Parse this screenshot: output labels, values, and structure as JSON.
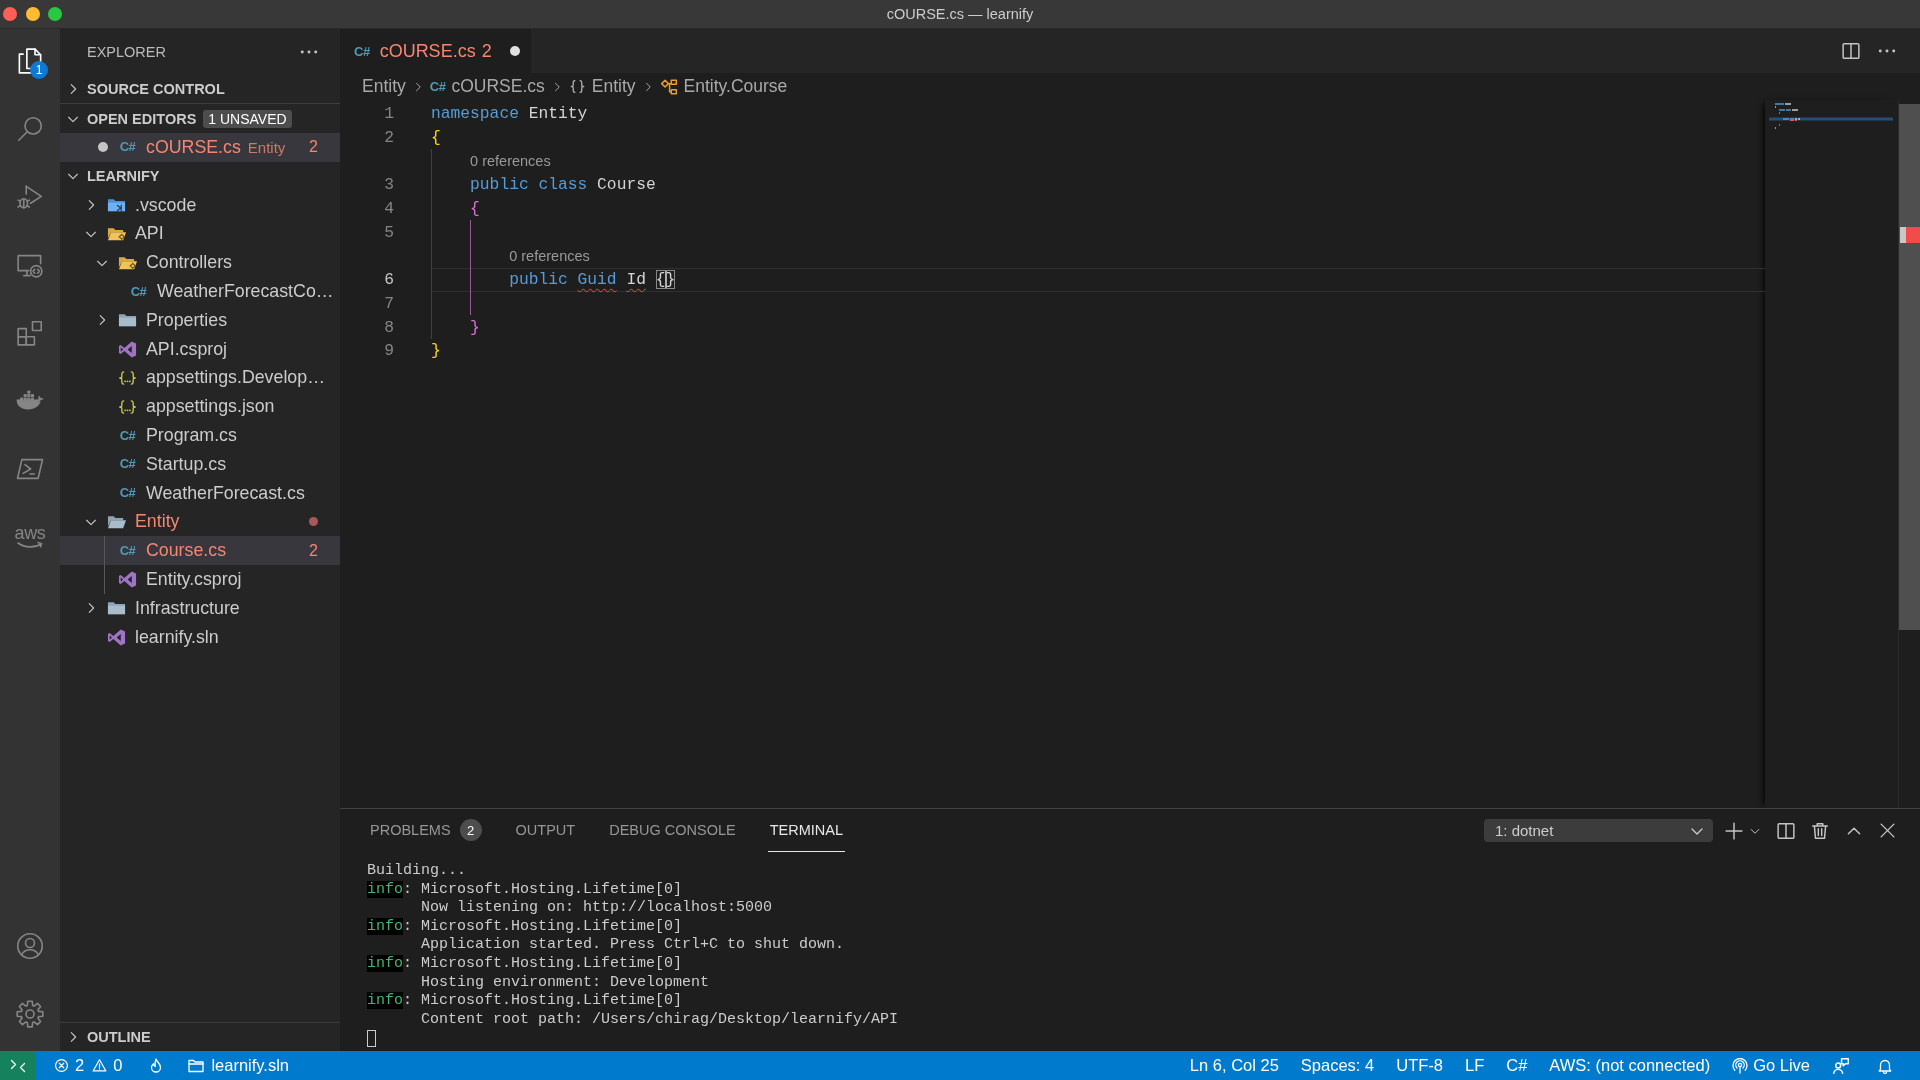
{
  "window": {
    "title": "cOURSE.cs — learnify"
  },
  "activity_bar": {
    "items": [
      {
        "kind": "explorer",
        "selected": true,
        "badge": "1"
      },
      {
        "kind": "search",
        "selected": false
      },
      {
        "kind": "debug",
        "selected": false
      },
      {
        "kind": "remote",
        "selected": false
      },
      {
        "kind": "extensions",
        "selected": false
      },
      {
        "kind": "docker",
        "selected": false
      },
      {
        "kind": "terminal",
        "selected": false
      },
      {
        "kind": "aws",
        "selected": false,
        "label": "aws"
      }
    ],
    "bottom_items": [
      {
        "kind": "account"
      },
      {
        "kind": "settings"
      }
    ]
  },
  "sidebar": {
    "title": "EXPLORER",
    "sections": [
      {
        "title": "SOURCE CONTROL",
        "expanded": false
      },
      {
        "title": "OPEN EDITORS",
        "expanded": true,
        "badge": "1 UNSAVED",
        "items": [
          {
            "kind": "csharp",
            "icon": "C#",
            "name": "cOURSE.cs",
            "description": "Entity",
            "problems": "2",
            "dirty": true,
            "error": true,
            "selected": true
          }
        ]
      },
      {
        "title": "LEARNIFY",
        "expanded": true,
        "tree": [
          {
            "kind": "vscodefolder",
            "name": ".vscode",
            "expanded": false,
            "selected": false,
            "error": false
          },
          {
            "kind": "gearfolder",
            "name": "API",
            "expanded": true,
            "selected": false,
            "error": false,
            "children": [
              {
                "kind": "gearfolder",
                "name": "Controllers",
                "expanded": true,
                "selected": false,
                "error": false,
                "children": [
                  {
                    "kind": "csharp",
                    "icon": "C#",
                    "name": "WeatherForecastCo…",
                    "selected": false,
                    "error": false
                  }
                ]
              },
              {
                "kind": "folder",
                "name": "Properties",
                "expanded": false,
                "selected": false,
                "error": false
              },
              {
                "kind": "msbuild",
                "name": "API.csproj",
                "selected": false,
                "error": false
              },
              {
                "kind": "json",
                "name": "appsettings.Develop…",
                "selected": false,
                "error": false
              },
              {
                "kind": "json",
                "name": "appsettings.json",
                "selected": false,
                "error": false
              },
              {
                "kind": "csharp",
                "icon": "C#",
                "name": "Program.cs",
                "selected": false,
                "error": false
              },
              {
                "kind": "csharp",
                "icon": "C#",
                "name": "Startup.cs",
                "selected": false,
                "error": false
              },
              {
                "kind": "csharp",
                "icon": "C#",
                "name": "WeatherForecast.cs",
                "selected": false,
                "error": false
              }
            ]
          },
          {
            "kind": "folder",
            "name": "Entity",
            "expanded": true,
            "selected": false,
            "error": true,
            "children": [
              {
                "kind": "csharp",
                "icon": "C#",
                "name": "Course.cs",
                "selected": true,
                "error": true,
                "problems": "2"
              },
              {
                "kind": "msbuild",
                "name": "Entity.csproj",
                "selected": false,
                "error": false
              }
            ]
          },
          {
            "kind": "folder",
            "name": "Infrastructure",
            "expanded": false,
            "selected": false,
            "error": false
          },
          {
            "kind": "msbuild",
            "name": "learnify.sln",
            "selected": false,
            "error": false
          }
        ]
      },
      {
        "title": "OUTLINE",
        "expanded": false
      }
    ]
  },
  "editor": {
    "tabs": [
      {
        "kind": "csharp",
        "icon": "C#",
        "name": "cOURSE.cs",
        "problems": "2",
        "dirty": true,
        "error": true,
        "selected": true
      }
    ],
    "breadcrumbs": [
      {
        "kind": "folder",
        "text": "Entity"
      },
      {
        "kind": "csharp",
        "icon": "C#",
        "text": "cOURSE.cs"
      },
      {
        "kind": "namespace",
        "text": "Entity"
      },
      {
        "kind": "class",
        "text": "Entity.Course"
      }
    ],
    "lines": [
      {
        "kind": "code",
        "number": "1",
        "active": false,
        "tokens": [
          {
            "kind": "keyword",
            "text": "namespace",
            "error": false,
            "cursor": false
          },
          {
            "kind": "plain",
            "text": "Entity",
            "error": false,
            "cursor": false
          }
        ]
      },
      {
        "kind": "code",
        "number": "2",
        "active": false,
        "tokens": [
          {
            "kind": "open",
            "text": "{",
            "error": false,
            "cursor": false
          }
        ]
      },
      {
        "kind": "codelens",
        "text": "0 references"
      },
      {
        "kind": "code",
        "number": "3",
        "active": false,
        "tokens": [
          {
            "kind": "keyword",
            "text": "public",
            "error": false,
            "cursor": false
          },
          {
            "kind": "keyword",
            "text": "class",
            "error": false,
            "cursor": false
          },
          {
            "kind": "plain",
            "text": "Course",
            "error": false,
            "cursor": false
          }
        ]
      },
      {
        "kind": "code",
        "number": "4",
        "active": false,
        "tokens": [
          {
            "kind": "open",
            "text": "{",
            "error": false,
            "cursor": false
          }
        ]
      },
      {
        "kind": "code",
        "number": "5",
        "active": false
      },
      {
        "kind": "codelens",
        "text": "0 references"
      },
      {
        "kind": "code",
        "number": "6",
        "active": true,
        "tokens": [
          {
            "kind": "keyword",
            "text": "public",
            "error": false,
            "cursor": false
          },
          {
            "kind": "type",
            "text": "Guid",
            "error": true,
            "cursor": false
          },
          {
            "kind": "plain",
            "text": "Id",
            "error": true,
            "cursor": false
          },
          {
            "kind": "pair",
            "text": "{}",
            "error": false,
            "cursor": true
          }
        ]
      },
      {
        "kind": "code",
        "number": "7",
        "active": false
      },
      {
        "kind": "code",
        "number": "8",
        "active": false,
        "tokens": [
          {
            "kind": "close",
            "text": "}",
            "error": false,
            "cursor": false
          }
        ]
      },
      {
        "kind": "code",
        "number": "9",
        "active": false,
        "tokens": [
          {
            "kind": "close",
            "text": "}",
            "error": false,
            "cursor": false
          }
        ]
      }
    ]
  },
  "panel": {
    "tabs": [
      {
        "label": "PROBLEMS",
        "badge": "2",
        "selected": false
      },
      {
        "label": "OUTPUT",
        "selected": false
      },
      {
        "label": "DEBUG CONSOLE",
        "selected": false
      },
      {
        "label": "TERMINAL",
        "selected": true
      }
    ],
    "terminal_select": {
      "value": "1: dotnet"
    },
    "terminal": {
      "focused": false,
      "lines": [
        {
          "kind": "plain",
          "segments": [
            {
              "kind": "message",
              "text": "Building..."
            }
          ]
        },
        {
          "kind": "plain",
          "segments": [
            {
              "kind": "level",
              "text": "info"
            },
            {
              "kind": "message",
              "text": ": Microsoft.Hosting.Lifetime[0]"
            }
          ]
        },
        {
          "kind": "continuation",
          "segments": [
            {
              "kind": "message",
              "text": "Now listening on: http://localhost:5000"
            }
          ]
        },
        {
          "kind": "plain",
          "segments": [
            {
              "kind": "level",
              "text": "info"
            },
            {
              "kind": "message",
              "text": ": Microsoft.Hosting.Lifetime[0]"
            }
          ]
        },
        {
          "kind": "continuation",
          "segments": [
            {
              "kind": "message",
              "text": "Application started. Press Ctrl+C to shut down."
            }
          ]
        },
        {
          "kind": "plain",
          "segments": [
            {
              "kind": "level",
              "text": "info"
            },
            {
              "kind": "message",
              "text": ": Microsoft.Hosting.Lifetime[0]"
            }
          ]
        },
        {
          "kind": "continuation",
          "segments": [
            {
              "kind": "message",
              "text": "Hosting environment: Development"
            }
          ]
        },
        {
          "kind": "plain",
          "segments": [
            {
              "kind": "level",
              "text": "info"
            },
            {
              "kind": "message",
              "text": ": Microsoft.Hosting.Lifetime[0]"
            }
          ]
        },
        {
          "kind": "continuation",
          "segments": [
            {
              "kind": "message",
              "text": "Content root path: /Users/chirag/Desktop/learnify/API"
            }
          ]
        }
      ]
    }
  },
  "status_bar": {
    "items": [
      {
        "kind": "remote"
      },
      {
        "kind": "problems",
        "errors": "2",
        "warnings": "0"
      },
      {
        "kind": "deploy"
      },
      {
        "kind": "project",
        "text": "learnify.sln"
      }
    ],
    "right_items": [
      {
        "kind": "text",
        "text": "Ln 6, Col 25"
      },
      {
        "kind": "text",
        "text": "Spaces: 4"
      },
      {
        "kind": "text",
        "text": "UTF-8"
      },
      {
        "kind": "text",
        "text": "LF"
      },
      {
        "kind": "text",
        "text": "C#"
      },
      {
        "kind": "text",
        "text": "AWS: (not connected)"
      },
      {
        "kind": "golive",
        "text": "Go Live"
      },
      {
        "kind": "feedback"
      },
      {
        "kind": "bell"
      }
    ]
  }
}
